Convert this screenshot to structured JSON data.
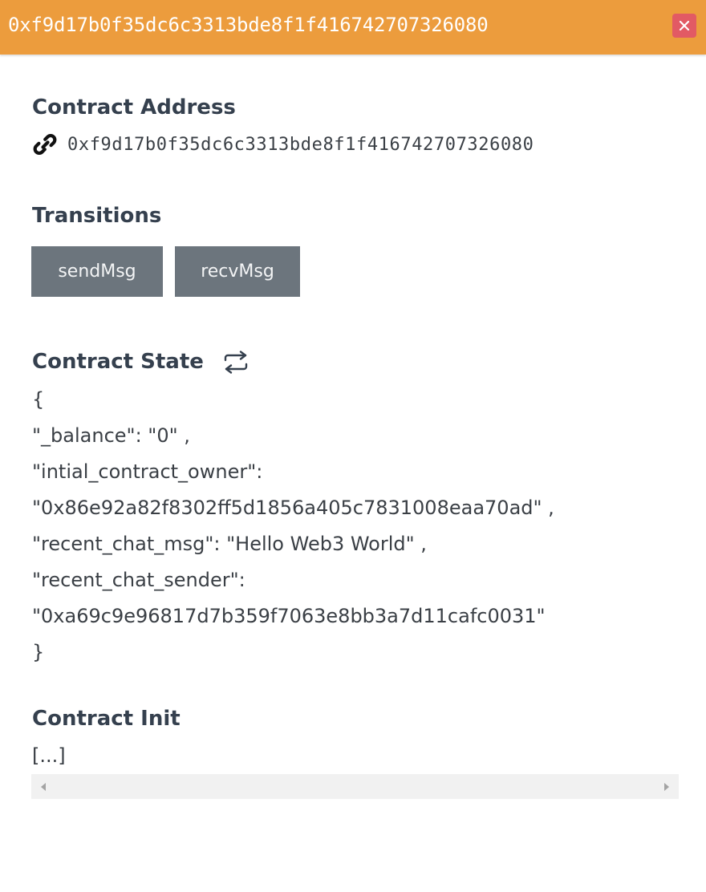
{
  "header": {
    "title": "0xf9d17b0f35dc6c3313bde8f1f416742707326080",
    "close_icon": "close-icon",
    "accent_color": "#ec9c3d",
    "close_color": "#e25a64"
  },
  "contract_address": {
    "title": "Contract Address",
    "icon": "link-icon",
    "value": "0xf9d17b0f35dc6c3313bde8f1f416742707326080"
  },
  "transitions": {
    "title": "Transitions",
    "buttons": [
      {
        "label": "sendMsg"
      },
      {
        "label": "recvMsg"
      }
    ],
    "button_color": "#6c757d"
  },
  "contract_state": {
    "title": "Contract State",
    "refresh_icon": "refresh-icon",
    "lines": [
      "{",
      "\"_balance\":  \"0\" ,",
      "\"intial_contract_owner\":",
      "\"0x86e92a82f8302ff5d1856a405c7831008eaa70ad\" ,",
      "\"recent_chat_msg\":  \"Hello Web3 World\" ,",
      "\"recent_chat_sender\":",
      "\"0xa69c9e96817d7b359f7063e8bb3a7d11cafc0031\"",
      "}"
    ]
  },
  "contract_init": {
    "title": "Contract Init",
    "value": "[...]",
    "scroll_left_icon": "scroll-left-arrow-icon",
    "scroll_right_icon": "scroll-right-arrow-icon"
  }
}
